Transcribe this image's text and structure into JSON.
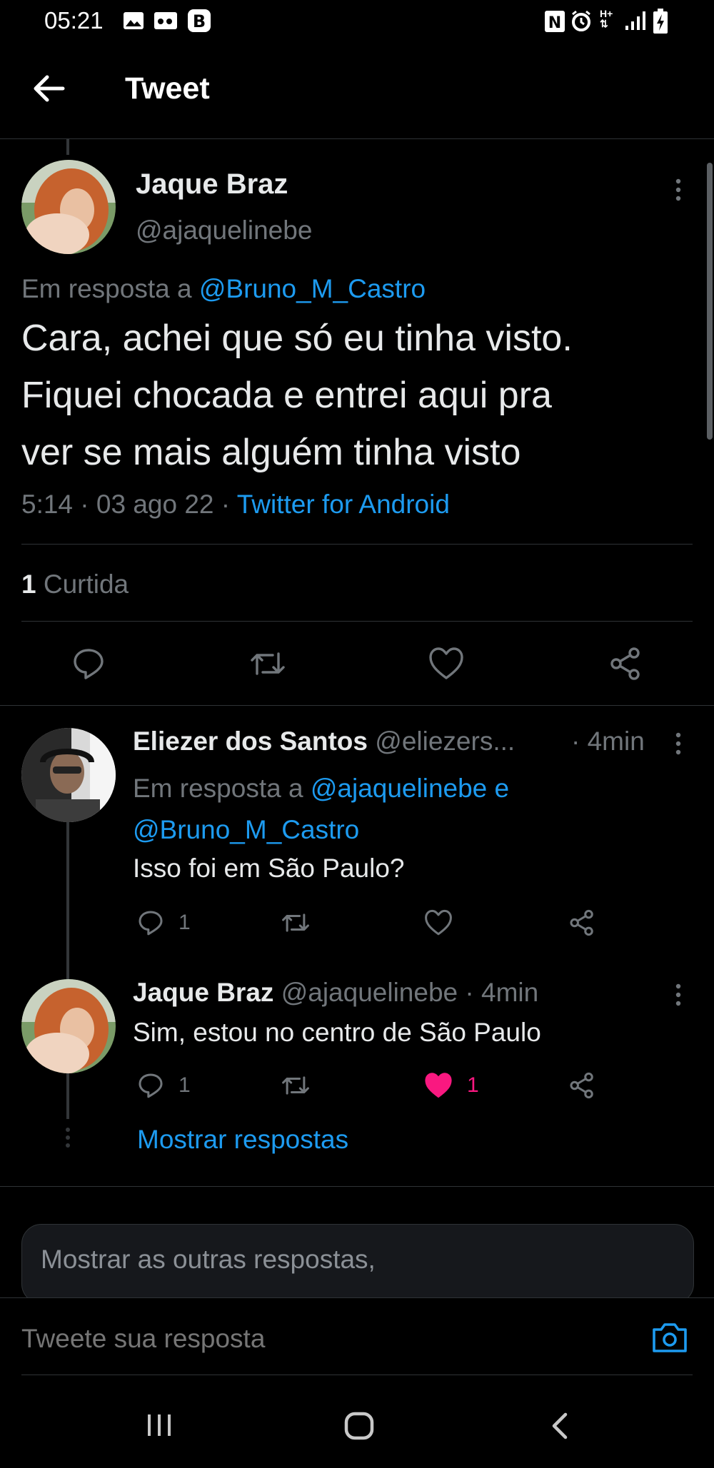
{
  "status_bar": {
    "time": "05:21",
    "icons": [
      "image-icon",
      "voicemail-icon",
      "b-app-icon",
      "nfc-icon",
      "alarm-icon",
      "h-plus-signal-icon",
      "cell-signal-icon",
      "battery-charging-icon"
    ]
  },
  "header": {
    "title": "Tweet",
    "back_icon": "arrow-left-icon"
  },
  "main_tweet": {
    "author_name": "Jaque Braz",
    "author_handle": "@ajaquelinebe",
    "reply_prefix": "Em resposta a",
    "reply_to": "@Bruno_M_Castro",
    "text_lines": [
      "Cara, achei que só eu tinha visto.",
      "Fiquei chocada e entrei aqui pra",
      "ver se mais alguém tinha visto"
    ],
    "time": "5:14 · 03 ago 22 ·",
    "source": "Twitter for Android",
    "likes_count": "1",
    "likes_label": "Curtida"
  },
  "replies": [
    {
      "author_name": "Eliezer dos Santos",
      "author_handle": "@eliezers...",
      "time": "· 4min",
      "reply_prefix": "Em resposta a",
      "reply_to_1": "@ajaquelinebe",
      "reply_joiner": "e",
      "reply_to_2": "@Bruno_M_Castro",
      "text": "Isso foi em São Paulo?",
      "reply_count": "1",
      "like_count": ""
    },
    {
      "author_name": "Jaque Braz",
      "author_handle": "@ajaquelinebe",
      "time": "· 4min",
      "text": "Sim, estou no centro de São Paulo",
      "reply_count": "1",
      "like_count": "1",
      "liked": true
    }
  ],
  "show_replies_label": "Mostrar respostas",
  "more_replies_text": "Mostrar as outras respostas,",
  "compose": {
    "placeholder": "Tweete sua resposta"
  },
  "colors": {
    "background": "#000000",
    "text": "#e7e9ea",
    "muted": "#71767b",
    "link": "#1d9bf0",
    "liked": "#f91880"
  }
}
